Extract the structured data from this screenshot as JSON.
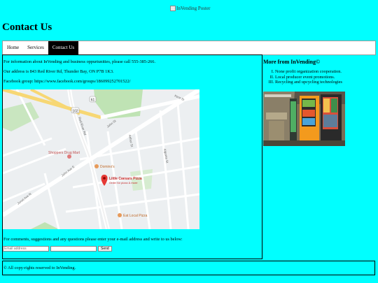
{
  "poster": {
    "alt": "InVending Poster"
  },
  "page_title": "Contact Us",
  "nav": {
    "items": [
      {
        "label": "Home"
      },
      {
        "label": "Services"
      },
      {
        "label": "Contact Us"
      }
    ]
  },
  "main": {
    "info_line": "For information about InVending and business oppurtunities, please call 555-385-266.",
    "address_line": "Our address is 843 Red River Rd, Thunder Bay, ON P7B 1K3.",
    "facebook_line": "Facebook group: https://www.facebook.com/groups/186099252701522/",
    "comments_line": "For comments, suggestions and any questions please enter your e-mail address and write to us below:",
    "form": {
      "email_placeholder": "Email address",
      "message_value": "",
      "send_label": "Send"
    }
  },
  "map": {
    "labels": {
      "shoppers": "Shoppers Drug Mart",
      "dominos": "Domino's",
      "caesars": "Little Caesars Pizza",
      "caesars_sub": "Order for pizza & more",
      "eat_local": "Eat Local Pizza",
      "john_st": "John St",
      "john_ave": "John Ave E",
      "red_river": "Red River Rd",
      "junot": "Junot Ave N",
      "arthur": "Arthur St",
      "kent": "Kent St",
      "algoma": "Algoma St",
      "hwy": "102",
      "hwy2": "61"
    }
  },
  "aside": {
    "heading": "More from InVending©",
    "items": [
      "None profit organization cooperation.",
      "Local producer event promotions.",
      "Recycling and upcycling technologies"
    ]
  },
  "footer": {
    "text": "© All copy-rights reserved to InVending."
  }
}
